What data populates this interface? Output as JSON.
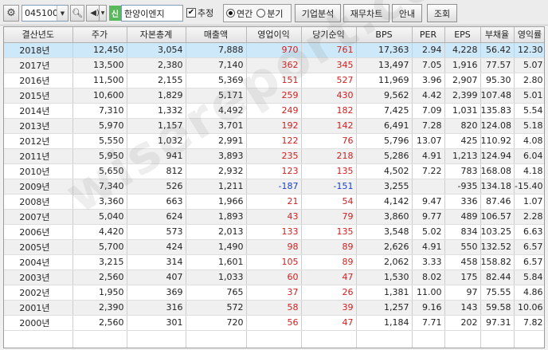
{
  "toolbar": {
    "gear_icon": "gear-icon",
    "code": "045100",
    "search_icon": "search-icon",
    "sound_icon": "speaker-icon",
    "badge": "신",
    "company": "한양이엔지",
    "estimate_label": "추정",
    "estimate_checked": true,
    "radio_annual": "연간",
    "radio_quarter": "분기",
    "btn_corp": "기업분석",
    "btn_fin": "재무차트",
    "btn_guide": "안내",
    "btn_query": "조회"
  },
  "table": {
    "headers": [
      "결산년도",
      "주가",
      "자본총계",
      "매출액",
      "영업이익",
      "당기순익",
      "BPS",
      "PER",
      "EPS",
      "부채율",
      "영익률"
    ],
    "rows": [
      [
        "2018년",
        "12,450",
        "3,054",
        "7,888",
        "970",
        "761",
        "17,363",
        "2.94",
        "4,228",
        "56.42",
        "12.30"
      ],
      [
        "2017년",
        "13,500",
        "2,380",
        "7,140",
        "362",
        "345",
        "13,497",
        "7.05",
        "1,916",
        "77.57",
        "5.07"
      ],
      [
        "2016년",
        "11,500",
        "2,155",
        "5,369",
        "151",
        "527",
        "11,969",
        "3.96",
        "2,907",
        "95.30",
        "2.80"
      ],
      [
        "2015년",
        "10,600",
        "1,829",
        "5,171",
        "259",
        "430",
        "9,562",
        "4.42",
        "2,399",
        "107.48",
        "5.01"
      ],
      [
        "2014년",
        "7,310",
        "1,332",
        "4,492",
        "249",
        "182",
        "7,425",
        "7.09",
        "1,031",
        "135.83",
        "5.54"
      ],
      [
        "2013년",
        "5,970",
        "1,157",
        "3,701",
        "192",
        "142",
        "6,491",
        "7.28",
        "820",
        "124.08",
        "5.18"
      ],
      [
        "2012년",
        "5,550",
        "1,032",
        "2,991",
        "122",
        "76",
        "5,796",
        "13.07",
        "425",
        "110.92",
        "4.08"
      ],
      [
        "2011년",
        "5,950",
        "941",
        "3,893",
        "235",
        "218",
        "5,286",
        "4.91",
        "1,213",
        "124.94",
        "6.04"
      ],
      [
        "2010년",
        "5,650",
        "812",
        "2,932",
        "123",
        "135",
        "4,502",
        "7.22",
        "783",
        "168.08",
        "4.18"
      ],
      [
        "2009년",
        "7,340",
        "526",
        "1,211",
        "-187",
        "-151",
        "3,255",
        "",
        "-935",
        "134.18",
        "-15.40"
      ],
      [
        "2008년",
        "3,360",
        "663",
        "1,966",
        "21",
        "54",
        "4,142",
        "9.47",
        "336",
        "87.46",
        "1.07"
      ],
      [
        "2007년",
        "5,040",
        "624",
        "1,893",
        "43",
        "79",
        "3,860",
        "9.77",
        "489",
        "106.57",
        "2.28"
      ],
      [
        "2006년",
        "4,420",
        "573",
        "2,013",
        "133",
        "135",
        "3,548",
        "5.02",
        "834",
        "103.25",
        "6.63"
      ],
      [
        "2005년",
        "5,700",
        "424",
        "1,490",
        "98",
        "89",
        "2,626",
        "4.91",
        "550",
        "132.52",
        "6.57"
      ],
      [
        "2004년",
        "3,215",
        "314",
        "1,601",
        "105",
        "89",
        "2,062",
        "3.33",
        "458",
        "158.82",
        "6.57"
      ],
      [
        "2003년",
        "2,560",
        "407",
        "1,033",
        "60",
        "47",
        "1,530",
        "8.02",
        "175",
        "82.44",
        "5.84"
      ],
      [
        "2002년",
        "1,950",
        "369",
        "765",
        "37",
        "26",
        "1,381",
        "11.00",
        "97",
        "75.55",
        "4.86"
      ],
      [
        "2001년",
        "2,390",
        "316",
        "572",
        "58",
        "39",
        "1,257",
        "9.16",
        "143",
        "59.58",
        "10.06"
      ],
      [
        "2000년",
        "2,560",
        "301",
        "720",
        "56",
        "47",
        "1,184",
        "7.71",
        "202",
        "97.31",
        "7.82"
      ]
    ]
  },
  "colors": {
    "positive": "#d21f1f",
    "negative": "#1a3fd0",
    "selected_row": "#cde8f8",
    "badge_bg": "#59b859"
  }
}
